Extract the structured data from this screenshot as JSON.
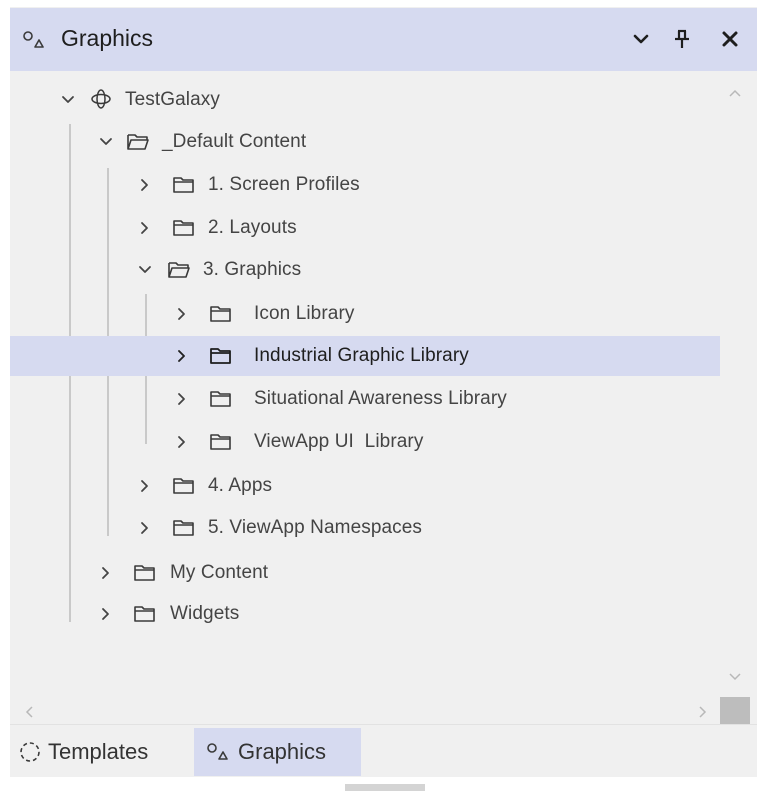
{
  "panel": {
    "title": "Graphics",
    "title_icon": "graphics-shapes-icon",
    "actions": {
      "menu_icon": "chevron-down-icon",
      "pin_icon": "pin-icon",
      "close_icon": "close-icon"
    }
  },
  "tree": {
    "root": {
      "label": "TestGalaxy",
      "icon": "galaxy-icon",
      "expanded": true
    },
    "items": [
      {
        "label": "_Default Content",
        "expanded": true
      },
      {
        "label": "1. Screen Profiles",
        "expanded": false
      },
      {
        "label": "2. Layouts",
        "expanded": false
      },
      {
        "label": "3. Graphics",
        "expanded": true
      },
      {
        "label": "Icon Library",
        "expanded": false
      },
      {
        "label": "Industrial Graphic Library",
        "expanded": false,
        "selected": true
      },
      {
        "label": "Situational Awareness Library",
        "expanded": false
      },
      {
        "label": "ViewApp UI  Library",
        "expanded": false
      },
      {
        "label": "4. Apps",
        "expanded": false
      },
      {
        "label": "5. ViewApp Namespaces",
        "expanded": false
      },
      {
        "label": "My Content",
        "expanded": false
      },
      {
        "label": "Widgets",
        "expanded": false
      }
    ]
  },
  "tabs": [
    {
      "label": "Templates",
      "icon": "templates-icon",
      "active": false
    },
    {
      "label": "Graphics",
      "icon": "graphics-shapes-icon",
      "active": true
    }
  ],
  "colors": {
    "header_bg": "#d6daf0",
    "selection_bg": "#d6daf0",
    "panel_bg": "#f0f0f0",
    "text": "#444444"
  }
}
